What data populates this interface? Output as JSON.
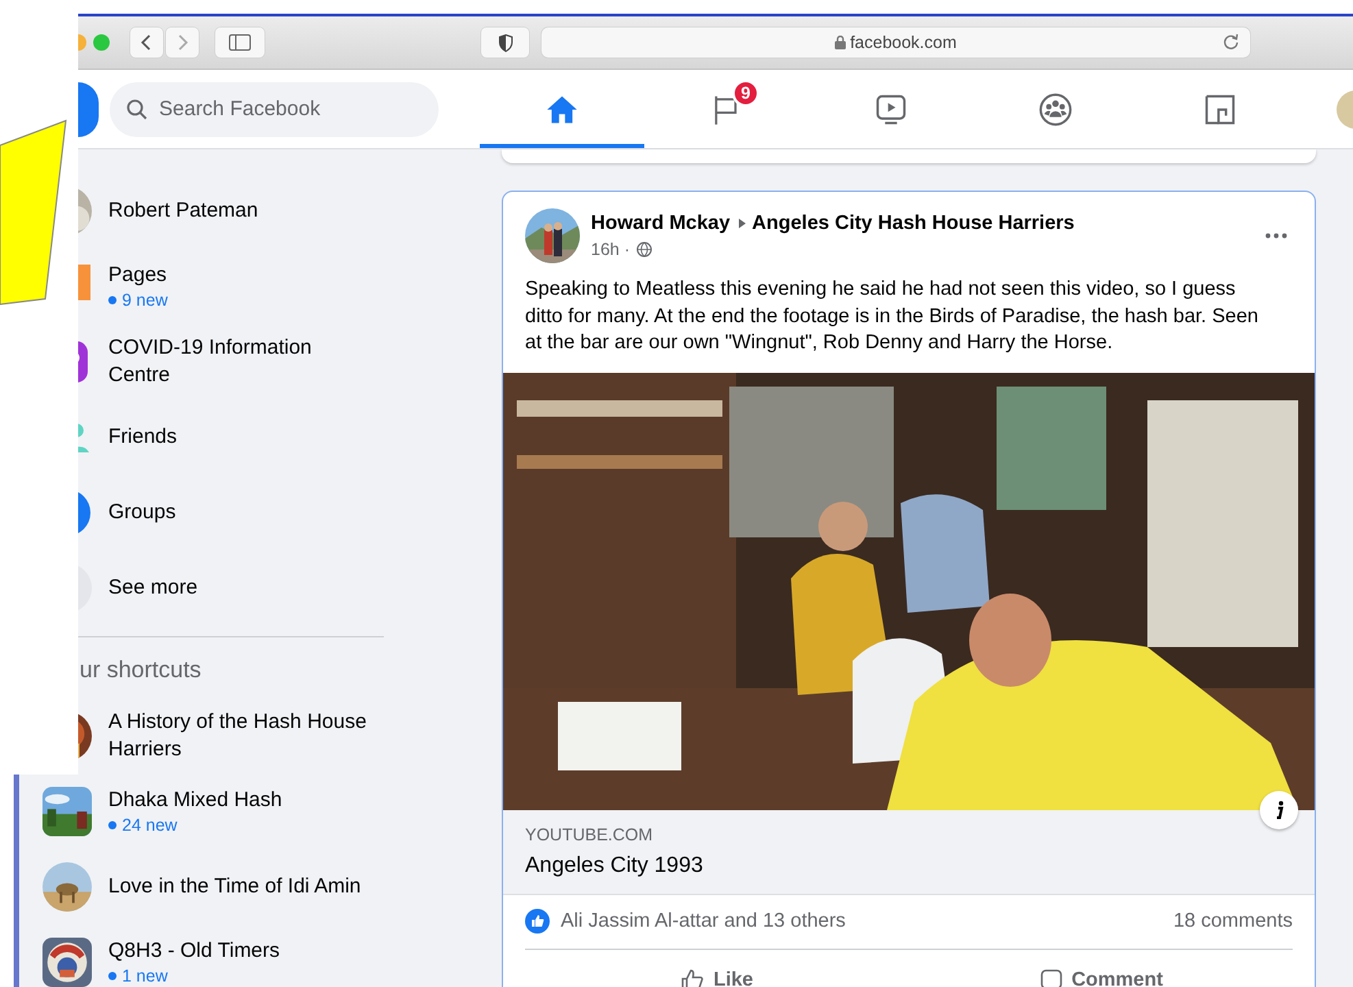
{
  "browser": {
    "url": "facebook.com"
  },
  "search": {
    "placeholder": "Search Facebook"
  },
  "nav_tabs": [
    {
      "kind": "home",
      "selected": true
    },
    {
      "kind": "flag",
      "selected": false,
      "badge": "9"
    },
    {
      "kind": "video",
      "selected": false
    },
    {
      "kind": "groups",
      "selected": false
    },
    {
      "kind": "gaming",
      "selected": false
    }
  ],
  "sidebar": {
    "items": [
      {
        "kind": "profile",
        "label": "Robert Pateman"
      },
      {
        "kind": "pages",
        "label": "Pages",
        "note": "9 new"
      },
      {
        "kind": "covid",
        "label": "COVID-19 Information Centre"
      },
      {
        "kind": "friends",
        "label": "Friends"
      },
      {
        "kind": "groups",
        "label": "Groups"
      },
      {
        "kind": "more",
        "label": "See more"
      }
    ],
    "shortcuts_heading": "ur shortcuts",
    "shortcuts": [
      {
        "label": "A History of the Hash House Harriers"
      },
      {
        "label": "Dhaka Mixed Hash",
        "note": "24 new"
      },
      {
        "label": "Love in the Time of Idi Amin"
      },
      {
        "label": "Q8H3 - Old Timers",
        "note": "1 new"
      }
    ]
  },
  "post": {
    "author": "Howard Mckay",
    "group": "Angeles City Hash House Harriers",
    "time": "16h ·",
    "text": "Speaking to Meatless this evening he said he had not seen this video, so I guess ditto for many. At the end the footage is in the Birds of Paradise, the hash bar. Seen at the bar are our own \"Wingnut\", Rob Denny and Harry the Horse.",
    "link": {
      "domain": "YOUTUBE.COM",
      "title": "Angeles City 1993"
    },
    "reactions": "Ali Jassim Al-attar and 13 others",
    "comments": "18 comments",
    "actions": [
      {
        "kind": "like",
        "label": "Like"
      },
      {
        "kind": "comment",
        "label": "Comment"
      }
    ]
  }
}
